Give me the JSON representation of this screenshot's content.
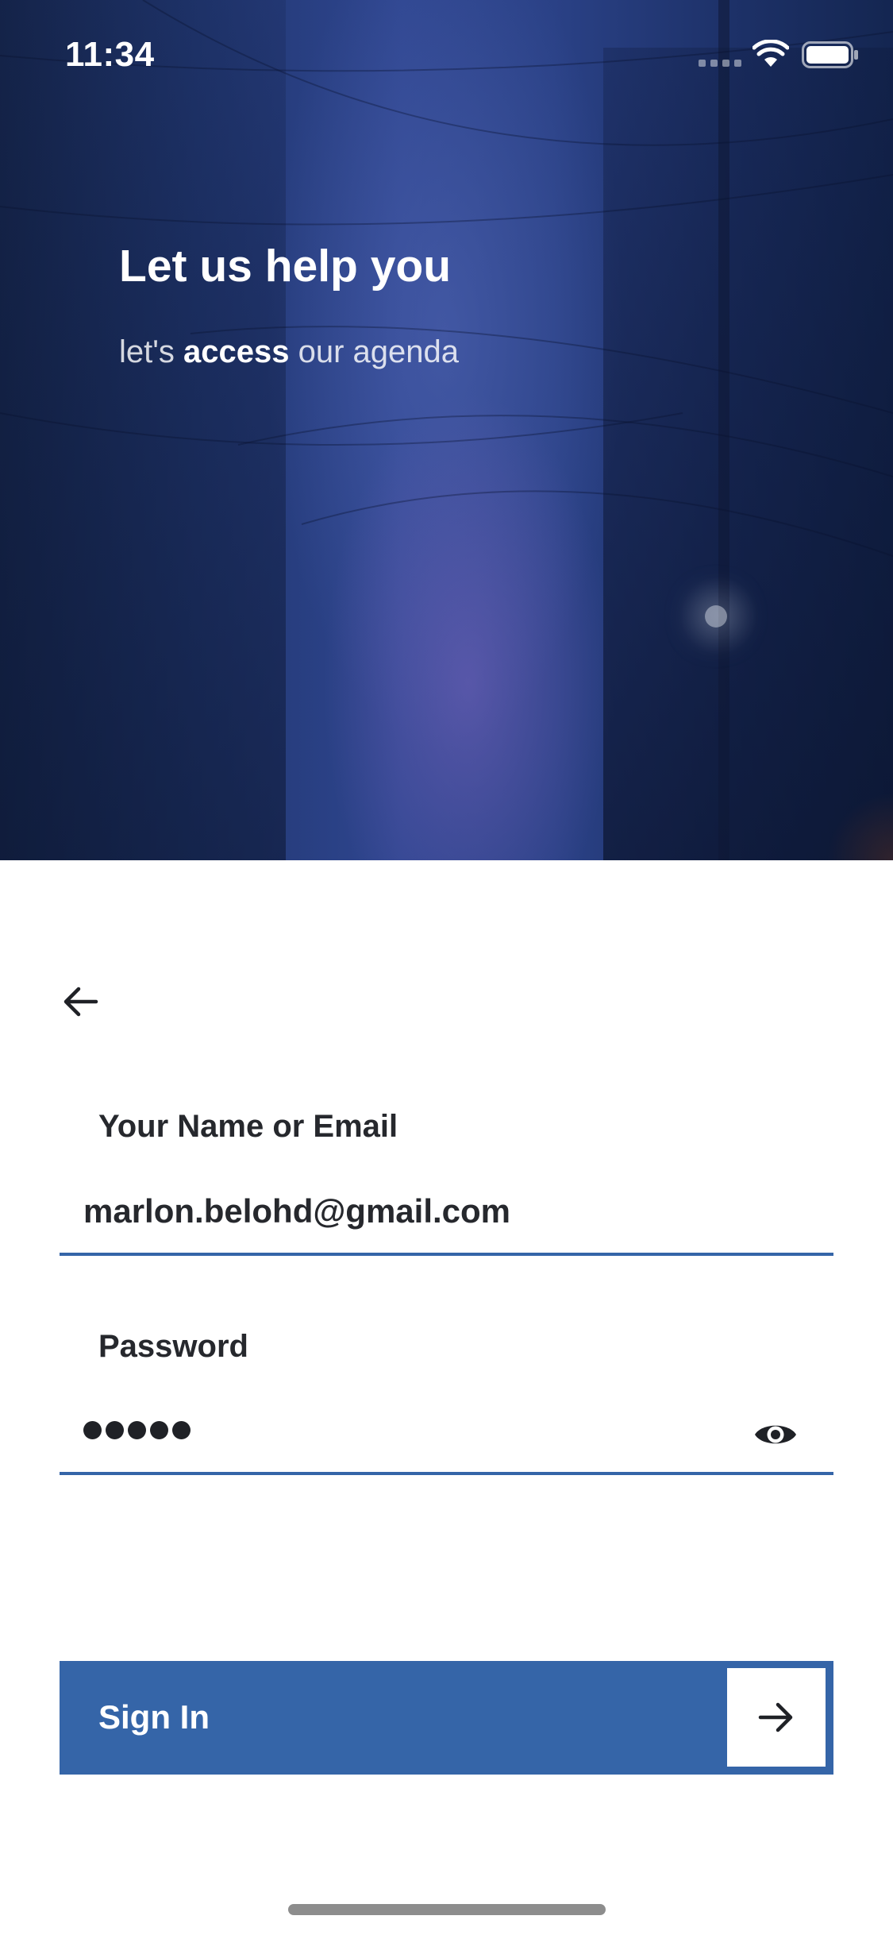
{
  "status_bar": {
    "time": "11:34",
    "icons": [
      "signal-dots-icon",
      "wifi-icon",
      "battery-icon"
    ]
  },
  "hero": {
    "title": "Let us help you",
    "subtitle_prefix": "let's ",
    "subtitle_emphasis": "access",
    "subtitle_suffix": " our agenda",
    "background_description_colors": [
      "#16264d",
      "#2f4690",
      "#142651"
    ]
  },
  "form": {
    "back_icon": "arrow-left-icon",
    "email": {
      "label": "Your Name or Email",
      "value": "marlon.belohd@gmail.com"
    },
    "password": {
      "label": "Password",
      "masked_length": 5,
      "toggle_icon": "eye-icon"
    },
    "sign_in": {
      "label": "Sign In",
      "icon": "arrow-right-icon"
    }
  },
  "colors": {
    "accent": "#3565a8",
    "text": "#26282d",
    "background": "#ffffff"
  }
}
